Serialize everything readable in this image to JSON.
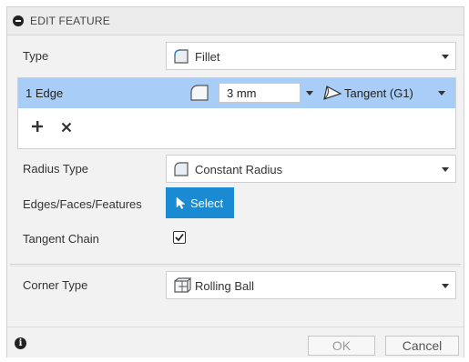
{
  "title": "EDIT FEATURE",
  "type_row": {
    "label": "Type",
    "value": "Fillet"
  },
  "edges": {
    "row_label": "1 Edge",
    "radius_value": "3 mm",
    "continuity": "Tangent (G1)"
  },
  "radius_type": {
    "label": "Radius Type",
    "value": "Constant Radius"
  },
  "selection": {
    "label": "Edges/Faces/Features",
    "button_label": "Select"
  },
  "tangent_chain": {
    "label": "Tangent Chain",
    "checked": true
  },
  "corner_type": {
    "label": "Corner Type",
    "value": "Rolling Ball"
  },
  "footer": {
    "info_glyph": "i",
    "ok_label": "OK",
    "cancel_label": "Cancel"
  },
  "colors": {
    "selection_row": "#a8cdf6",
    "select_button": "#1a8ad2"
  }
}
